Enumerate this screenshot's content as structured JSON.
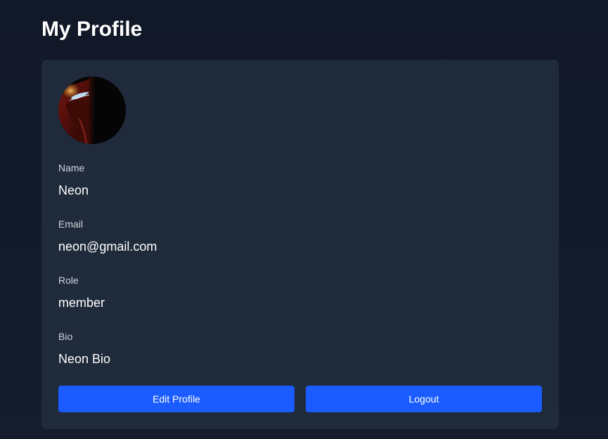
{
  "page": {
    "title": "My Profile"
  },
  "profile": {
    "avatar_alt": "profile-avatar",
    "fields": [
      {
        "label": "Name",
        "value": "Neon"
      },
      {
        "label": "Email",
        "value": "neon@gmail.com"
      },
      {
        "label": "Role",
        "value": "member"
      },
      {
        "label": "Bio",
        "value": "Neon Bio"
      }
    ]
  },
  "actions": {
    "edit_label": "Edit Profile",
    "logout_label": "Logout"
  },
  "colors": {
    "background": "#111827",
    "card": "#1f2a3b",
    "accent": "#1a5cff",
    "label_text": "#d1d5db",
    "value_text": "#ffffff"
  }
}
